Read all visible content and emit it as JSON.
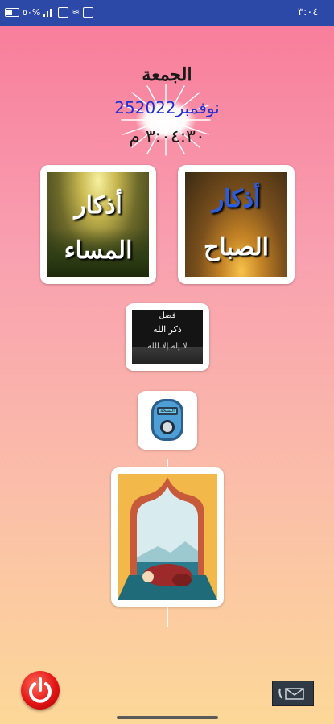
{
  "status_bar": {
    "time": "٣:٠٤",
    "battery": "٥٠%"
  },
  "header": {
    "day_name": "الجمعة",
    "date": "25نوفمبر2022",
    "time": "٣:٠٤:٣٠ م"
  },
  "cards": {
    "evening_adhkar": {
      "line1": "أذكار",
      "line2": "المساء"
    },
    "morning_adhkar": {
      "line1": "أذكار",
      "line2": "الصباح"
    },
    "virtue_dhikr": {
      "line1": "فضل",
      "line2": "ذكر الله",
      "line3": "لا إله إلا الله"
    },
    "tasbeeh": {
      "screen_label": "السبحة"
    }
  },
  "icons": {
    "power": "power-icon",
    "contact": "contact-icon"
  },
  "colors": {
    "status_bar": "#2d49a8",
    "date_text": "#1f2fd6",
    "power_button": "#e31616"
  }
}
